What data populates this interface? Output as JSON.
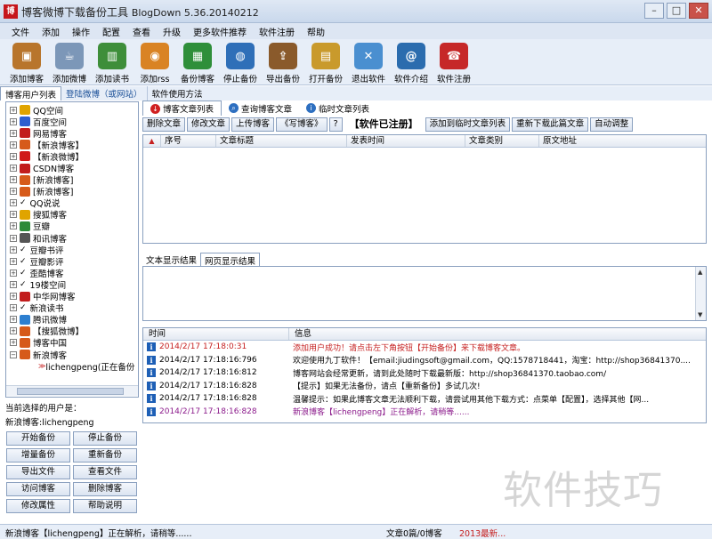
{
  "window": {
    "title": "博客微博下载备份工具",
    "version": "BlogDown 5.36.20140212",
    "app_icon_text": "博"
  },
  "menu": [
    "文件",
    "添加",
    "操作",
    "配置",
    "查看",
    "升级",
    "更多软件推荐",
    "软件注册",
    "帮助"
  ],
  "toolbar": [
    {
      "label": "添加博客",
      "icon": "box-icon",
      "color": "#b8752c",
      "glyph": "▣"
    },
    {
      "label": "添加微博",
      "icon": "cup-icon",
      "color": "#7c97b8",
      "glyph": "☕"
    },
    {
      "label": "添加读书",
      "icon": "books-icon",
      "color": "#3e8e3a",
      "glyph": "▥"
    },
    {
      "label": "添加rss",
      "icon": "rss-icon",
      "color": "#d98324",
      "glyph": "◉"
    },
    {
      "label": "备份博客",
      "icon": "cube-icon",
      "color": "#2f8f3a",
      "glyph": "▦"
    },
    {
      "label": "停止备份",
      "icon": "globe-icon",
      "color": "#2f6fb8",
      "glyph": "◍"
    },
    {
      "label": "导出备份",
      "icon": "export-icon",
      "color": "#8a5a2b",
      "glyph": "⇪"
    },
    {
      "label": "打开备份",
      "icon": "folder-icon",
      "color": "#c99a2c",
      "glyph": "▤"
    },
    {
      "label": "退出软件",
      "icon": "trash-icon",
      "color": "#4a8fd0",
      "glyph": "✕"
    },
    {
      "label": "软件介绍",
      "icon": "book-icon",
      "color": "#2b6cae",
      "glyph": "@"
    },
    {
      "label": "软件注册",
      "icon": "phone-icon",
      "color": "#c62828",
      "glyph": "☎"
    }
  ],
  "left_tabs": [
    "博客用户列表",
    "登陆微博（或网站）",
    "软件使用方法"
  ],
  "tree": [
    {
      "label": "QQ空间",
      "icon_color": "#e0a400",
      "check": ""
    },
    {
      "label": "百度空间",
      "icon_color": "#2d5fd0",
      "check": ""
    },
    {
      "label": "网易博客",
      "icon_color": "#c21d1d",
      "check": ""
    },
    {
      "label": "【新浪博客】",
      "icon_color": "#d65a1a",
      "check": ""
    },
    {
      "label": "【新浪微博】",
      "icon_color": "#d01a1a",
      "check": ""
    },
    {
      "label": "CSDN博客",
      "icon_color": "#c21d1d",
      "check": ""
    },
    {
      "label": "[新浪博客]",
      "icon_color": "#d65a1a",
      "check": ""
    },
    {
      "label": "[新浪博客]",
      "icon_color": "#d65a1a",
      "check": ""
    },
    {
      "label": "QQ说说",
      "icon_color": "",
      "check": "✓"
    },
    {
      "label": "搜狐博客",
      "icon_color": "#e0a400",
      "check": ""
    },
    {
      "label": "豆瓣",
      "icon_color": "#2d8a3a",
      "check": ""
    },
    {
      "label": "和讯博客",
      "icon_color": "#555",
      "check": ""
    },
    {
      "label": "豆瓣书评",
      "icon_color": "",
      "check": "✓"
    },
    {
      "label": "豆瓣影评",
      "icon_color": "",
      "check": "✓"
    },
    {
      "label": "歪酷博客",
      "icon_color": "",
      "check": "✓"
    },
    {
      "label": "19楼空间",
      "icon_color": "",
      "check": "✓"
    },
    {
      "label": "中华网博客",
      "icon_color": "#c21d1d",
      "check": ""
    },
    {
      "label": "新浪读书",
      "icon_color": "",
      "check": "✓"
    },
    {
      "label": "腾讯微博",
      "icon_color": "#2d7fd0",
      "check": ""
    },
    {
      "label": "【搜狐微博】",
      "icon_color": "#d65a1a",
      "check": ""
    },
    {
      "label": "博客中国",
      "icon_color": "#d65a1a",
      "check": ""
    },
    {
      "label": "新浪博客",
      "icon_color": "#d65a1a",
      "check": ""
    },
    {
      "label": "lichengpeng(正在备份",
      "icon_color": "",
      "check": "",
      "child": true
    }
  ],
  "current_user": {
    "label": "当前选择的用户是：",
    "value": "新浪博客:lichengpeng"
  },
  "left_buttons": [
    "开始备份",
    "停止备份",
    "增量备份",
    "重新备份",
    "导出文件",
    "查看文件",
    "访问博客",
    "删除博客",
    "修改属性",
    "帮助说明"
  ],
  "right_tabs": [
    "博客文章列表",
    "查询博客文章",
    "临时文章列表"
  ],
  "action_buttons": [
    "删除文章",
    "修改文章",
    "上传博客",
    "《写博客》",
    "?"
  ],
  "registered_label": "【软件已注册】",
  "action_buttons_right": [
    "添加到临时文章列表",
    "重新下载此篇文章",
    "自动调整"
  ],
  "article_columns": [
    "序号",
    "文章标题",
    "发表时间",
    "文章类别",
    "原文地址"
  ],
  "sub_tabs": [
    "文本显示结果",
    "网页显示结果"
  ],
  "log_columns": [
    "时间",
    "信息"
  ],
  "log_rows": [
    {
      "time": "2014/2/17  17:18:0:31",
      "msg": "添加用户成功！请点击左下角按钮【开始备份】来下载博客文章。",
      "color": "#c62020"
    },
    {
      "time": "2014/2/17  17:18:16:796",
      "msg": "欢迎使用九丁软件！【email:jiudingsoft@gmail.com，QQ:1578718441，淘宝：http://shop36841370....",
      "color": "#000"
    },
    {
      "time": "2014/2/17  17:18:16:812",
      "msg": "博客网站会经常更新，请到此处随时下载最新版：http://shop36841370.taobao.com/",
      "color": "#000"
    },
    {
      "time": "2014/2/17  17:18:16:828",
      "msg": "【提示】如果无法备份，请点【重新备份】多试几次!",
      "color": "#000"
    },
    {
      "time": "2014/2/17  17:18:16:828",
      "msg": "温馨提示：如果此博客文章无法顺利下载，请尝试用其他下载方式：点菜单【配置】，选择其他【网...",
      "color": "#000"
    },
    {
      "time": "2014/2/17  17:18:16:828",
      "msg": "新浪博客【lichengpeng】正在解析，请稍等......",
      "color": "#8b1a8b"
    }
  ],
  "watermark": "软件技巧",
  "status": {
    "left": "新浪博客【lichengpeng】正在解析，请稍等......",
    "mid": "文章0篇/0博客",
    "right": "2013最新..."
  }
}
